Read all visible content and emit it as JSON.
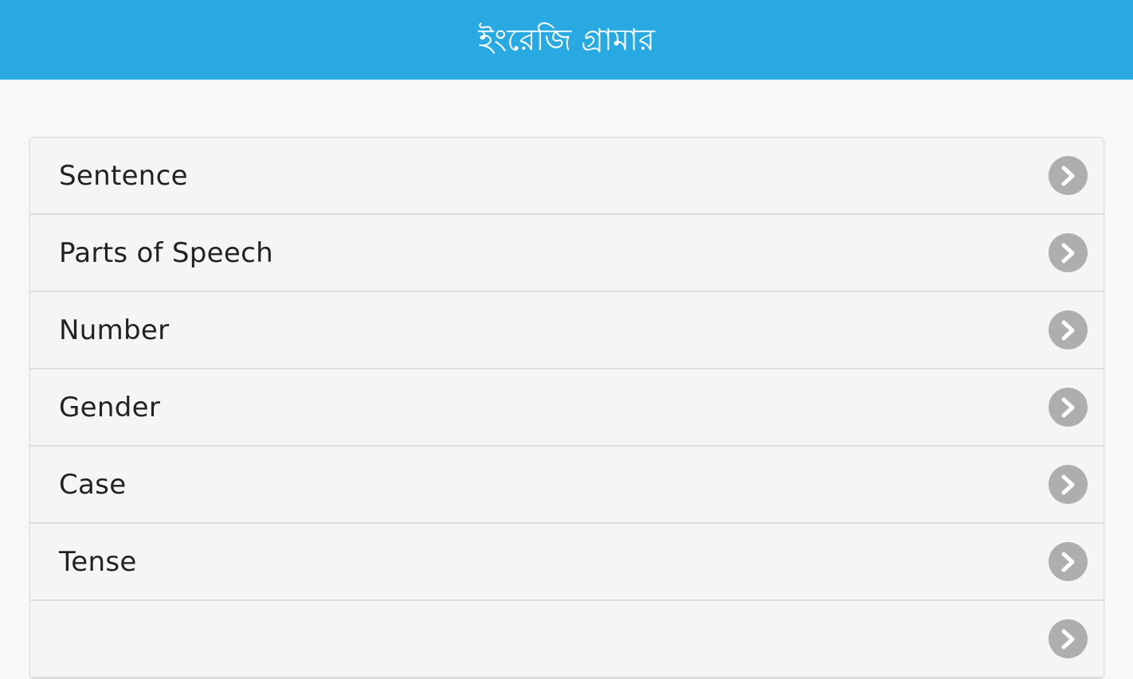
{
  "header": {
    "title": "ইংরেজি গ্রামার",
    "background_color": "#29a9e1"
  },
  "menu": {
    "items": [
      {
        "label": "Sentence",
        "icon": "chevron-right-icon"
      },
      {
        "label": "Parts of Speech",
        "icon": "chevron-right-icon"
      },
      {
        "label": "Number",
        "icon": "chevron-right-icon"
      },
      {
        "label": "Gender",
        "icon": "chevron-right-icon"
      },
      {
        "label": "Case",
        "icon": "chevron-right-icon"
      },
      {
        "label": "Tense",
        "icon": "chevron-right-icon"
      },
      {
        "label": "",
        "icon": "chevron-right-icon"
      }
    ]
  }
}
